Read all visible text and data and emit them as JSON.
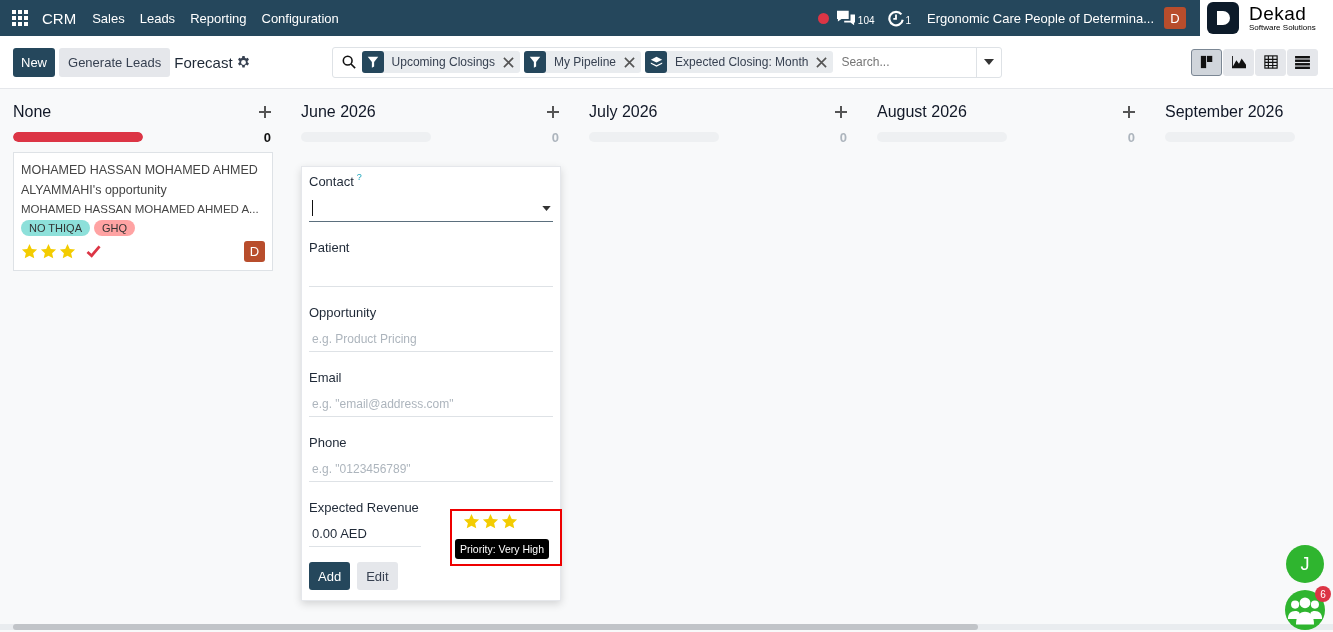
{
  "navbar": {
    "app": "CRM",
    "menus": [
      "Sales",
      "Leads",
      "Reporting",
      "Configuration"
    ],
    "recording": true,
    "messages_count": "104",
    "activities_count": "1",
    "company": "Ergonomic Care People of Determina...",
    "user_initial": "D",
    "brand": {
      "name": "Dekad",
      "tagline": "Software Solutions"
    }
  },
  "control_panel": {
    "buttons": [
      {
        "label": "New",
        "kind": "primary"
      },
      {
        "label": "Generate Leads",
        "kind": "secondary"
      }
    ],
    "title": "Forecast",
    "facets": [
      {
        "kind": "filter",
        "label": "Upcoming Closings"
      },
      {
        "kind": "filter",
        "label": "My Pipeline"
      },
      {
        "kind": "group",
        "label": "Expected Closing: Month"
      }
    ],
    "search": {
      "placeholder": "Search..."
    },
    "views": [
      {
        "kind": "kanban",
        "selected": true
      },
      {
        "kind": "graph",
        "selected": false
      },
      {
        "kind": "pivot",
        "selected": false
      },
      {
        "kind": "list",
        "selected": false
      }
    ]
  },
  "columns": [
    {
      "title": "None",
      "total": "0",
      "level": 1,
      "color": "#dc3545",
      "cards": [
        {
          "title": "MOHAMED HASSAN MOHAMED AHMED ALYAMMAHI's opportunity",
          "subtitle": "MOHAMED HASSAN MOHAMED AHMED A...",
          "tags": [
            {
              "label": "NO THIQA",
              "color": "#8de0da"
            },
            {
              "label": "GHQ",
              "color": "#ffa3a3"
            }
          ],
          "stars": 3,
          "done": true,
          "avatar": "D"
        }
      ]
    },
    {
      "title": "June 2026",
      "total": "0",
      "quick_create": true
    },
    {
      "title": "July 2026",
      "total": "0"
    },
    {
      "title": "August 2026",
      "total": "0"
    },
    {
      "title": "September 2026"
    }
  ],
  "quick_create": {
    "fields": [
      {
        "label": "Contact",
        "help": "?",
        "kind": "dropdown"
      },
      {
        "label": "Patient",
        "kind": "text"
      },
      {
        "label": "Opportunity",
        "kind": "text",
        "placeholder": "e.g. Product Pricing"
      },
      {
        "label": "Email",
        "kind": "text",
        "placeholder": "e.g. \"email@address.com\""
      },
      {
        "label": "Phone",
        "kind": "text",
        "placeholder": "e.g. \"0123456789\""
      },
      {
        "label": "Expected Revenue",
        "kind": "money",
        "value": "0.00 AED"
      }
    ],
    "stars": 3,
    "tooltip": "Priority: Very High",
    "highlighted": true,
    "buttons": [
      {
        "label": "Add",
        "kind": "primary"
      },
      {
        "label": "Edit",
        "kind": "secondary"
      }
    ]
  },
  "chat": [
    {
      "kind": "user",
      "initial": "J"
    },
    {
      "kind": "group",
      "badge": "6"
    }
  ]
}
